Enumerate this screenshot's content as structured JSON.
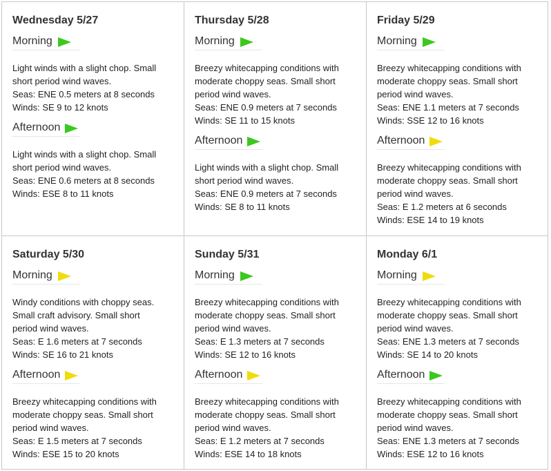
{
  "days": [
    {
      "title": "Wednesday 5/27",
      "morning": {
        "label": "Morning",
        "flag": "green",
        "lines": [
          "Light winds with a slight chop. Small",
          "short period wind waves."
        ],
        "seas": "Seas: ENE 0.5 meters at 8 seconds",
        "winds": "Winds: SE 9 to 12 knots"
      },
      "afternoon": {
        "label": "Afternoon",
        "flag": "green",
        "lines": [
          "Light winds with a slight chop. Small",
          "short period wind waves."
        ],
        "seas": "Seas: ENE 0.6 meters at 8 seconds",
        "winds": "Winds: ESE 8 to 11 knots"
      }
    },
    {
      "title": "Thursday 5/28",
      "morning": {
        "label": "Morning",
        "flag": "green",
        "lines": [
          "Breezy whitecapping conditions with",
          "moderate choppy seas. Small short",
          "period wind waves."
        ],
        "seas": "Seas: ENE 0.9 meters at 7 seconds",
        "winds": "Winds: SE 11 to 15 knots"
      },
      "afternoon": {
        "label": "Afternoon",
        "flag": "green",
        "lines": [
          "Light winds with a slight chop. Small",
          "short period wind waves."
        ],
        "seas": "Seas: ENE 0.9 meters at 7 seconds",
        "winds": "Winds: SE 8 to 11 knots"
      }
    },
    {
      "title": "Friday 5/29",
      "morning": {
        "label": "Morning",
        "flag": "green",
        "lines": [
          "Breezy whitecapping conditions with",
          "moderate choppy seas. Small short",
          "period wind waves."
        ],
        "seas": "Seas: ENE 1.1 meters at 7 seconds",
        "winds": "Winds: SSE 12 to 16 knots"
      },
      "afternoon": {
        "label": "Afternoon",
        "flag": "yellow",
        "lines": [
          "Breezy whitecapping conditions with",
          "moderate choppy seas. Small short",
          "period wind waves."
        ],
        "seas": "Seas: E 1.2 meters at 6 seconds",
        "winds": "Winds: ESE 14 to 19 knots"
      }
    },
    {
      "title": "Saturday 5/30",
      "morning": {
        "label": "Morning",
        "flag": "yellow",
        "lines": [
          "Windy conditions with choppy seas.",
          "Small craft advisory. Small short",
          "period wind waves."
        ],
        "seas": "Seas: E 1.6 meters at 7 seconds",
        "winds": "Winds: SE 16 to 21 knots"
      },
      "afternoon": {
        "label": "Afternoon",
        "flag": "yellow",
        "lines": [
          "Breezy whitecapping conditions with",
          "moderate choppy seas. Small short",
          "period wind waves."
        ],
        "seas": "Seas: E 1.5 meters at 7 seconds",
        "winds": "Winds: ESE 15 to 20 knots"
      }
    },
    {
      "title": "Sunday 5/31",
      "morning": {
        "label": "Morning",
        "flag": "green",
        "lines": [
          "Breezy whitecapping conditions with",
          "moderate choppy seas. Small short",
          "period wind waves."
        ],
        "seas": "Seas: E 1.3 meters at 7 seconds",
        "winds": "Winds: SE 12 to 16 knots"
      },
      "afternoon": {
        "label": "Afternoon",
        "flag": "yellow",
        "lines": [
          "Breezy whitecapping conditions with",
          "moderate choppy seas. Small short",
          "period wind waves."
        ],
        "seas": "Seas: E 1.2 meters at 7 seconds",
        "winds": "Winds: ESE 14 to 18 knots"
      }
    },
    {
      "title": "Monday 6/1",
      "morning": {
        "label": "Morning",
        "flag": "yellow",
        "lines": [
          "Breezy whitecapping conditions with",
          "moderate choppy seas. Small short",
          "period wind waves."
        ],
        "seas": "Seas: ENE 1.3 meters at 7 seconds",
        "winds": "Winds: SE 14 to 20 knots"
      },
      "afternoon": {
        "label": "Afternoon",
        "flag": "green",
        "lines": [
          "Breezy whitecapping conditions with",
          "moderate choppy seas. Small short",
          "period wind waves."
        ],
        "seas": "Seas: ENE 1.3 meters at 7 seconds",
        "winds": "Winds: ESE 12 to 16 knots"
      }
    }
  ],
  "colors": {
    "green_flag": "#3cc81e",
    "yellow_flag": "#f0dc0a",
    "border": "#c8c8c8"
  }
}
